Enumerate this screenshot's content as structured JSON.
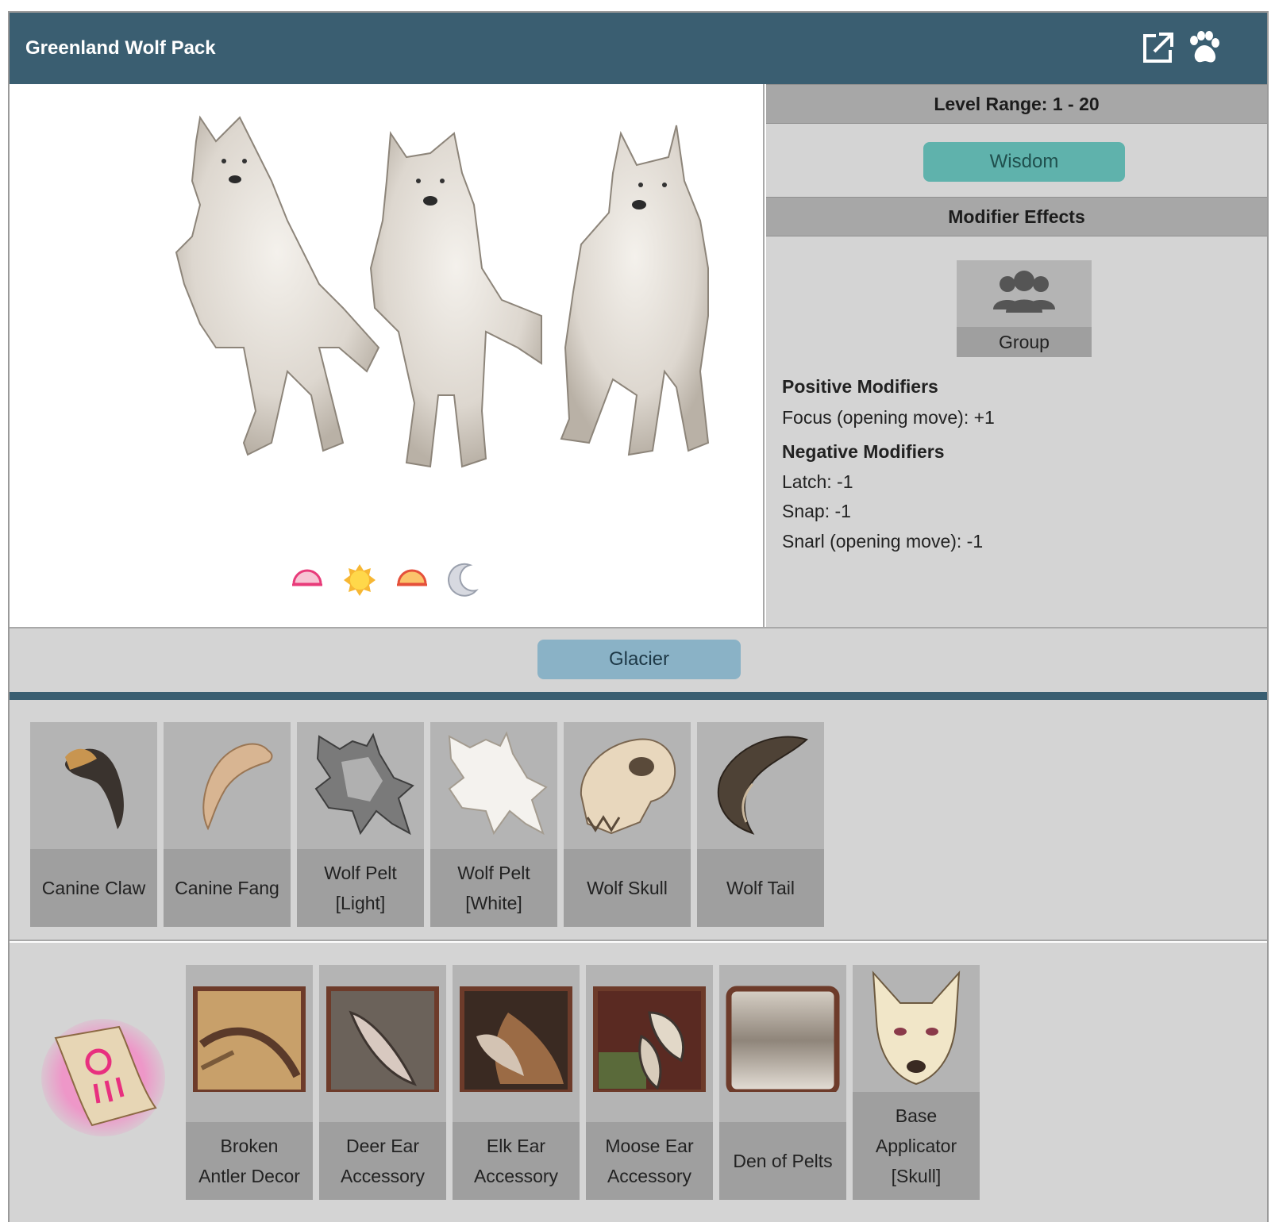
{
  "header": {
    "title": "Greenland Wolf Pack",
    "icons": [
      "external-link-icon",
      "paw-icon"
    ]
  },
  "time_of_day_icons": [
    "dawn-icon",
    "day-icon",
    "dusk-icon",
    "night-icon"
  ],
  "info": {
    "level_range": "Level Range: 1 - 20",
    "stat_button": "Wisdom",
    "modifier_effects_title": "Modifier Effects",
    "group_label": "Group",
    "positive_title": "Positive Modifiers",
    "positive": [
      "Focus (opening move): +1"
    ],
    "negative_title": "Negative Modifiers",
    "negative": [
      "Latch: -1",
      "Snap: -1",
      "Snarl (opening move): -1"
    ]
  },
  "habitat": {
    "label": "Glacier"
  },
  "drops": [
    {
      "label_1": "Canine Claw",
      "label_2": ""
    },
    {
      "label_1": "Canine Fang",
      "label_2": ""
    },
    {
      "label_1": "Wolf Pelt",
      "label_2": "[Light]"
    },
    {
      "label_1": "Wolf Pelt",
      "label_2": "[White]"
    },
    {
      "label_1": "Wolf Skull",
      "label_2": ""
    },
    {
      "label_1": "Wolf Tail",
      "label_2": ""
    }
  ],
  "crafts": [
    {
      "label_1": "Broken",
      "label_2": "Antler Decor",
      "label_3": ""
    },
    {
      "label_1": "Deer Ear",
      "label_2": "Accessory",
      "label_3": ""
    },
    {
      "label_1": "Elk Ear",
      "label_2": "Accessory",
      "label_3": ""
    },
    {
      "label_1": "Moose Ear",
      "label_2": "Accessory",
      "label_3": ""
    },
    {
      "label_1": "Den of Pelts",
      "label_2": "",
      "label_3": ""
    },
    {
      "label_1": "Base",
      "label_2": "Applicator",
      "label_3": "[Skull]"
    }
  ],
  "colors": {
    "header": "#3a5e71",
    "wisdom": "#5fb2ac",
    "glacier": "#8ab2c6",
    "panel": "#d4d4d4",
    "tile": "#b4b4b4",
    "tile_label": "#9f9f9f"
  }
}
